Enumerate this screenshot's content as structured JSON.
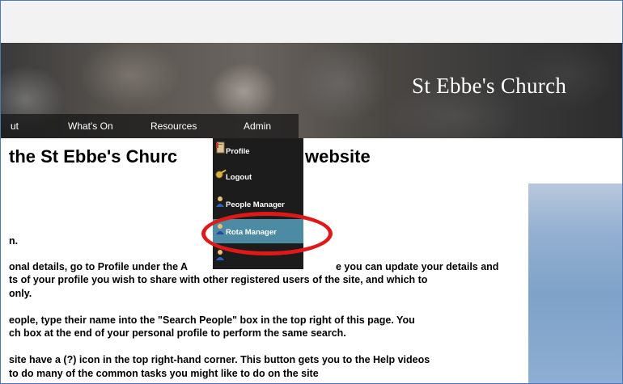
{
  "site": {
    "title": "St Ebbe's Church"
  },
  "nav": {
    "items": [
      {
        "label": "ut"
      },
      {
        "label": "What's On"
      },
      {
        "label": "Resources"
      },
      {
        "label": "Admin"
      }
    ]
  },
  "dropdown": {
    "items": [
      {
        "label": "Profile",
        "icon": "document-icon"
      },
      {
        "label": "Logout",
        "icon": "key-icon"
      },
      {
        "label": "People Manager",
        "icon": "person-icon"
      },
      {
        "label": "Rota Manager",
        "icon": "person-icon",
        "highlighted": true
      },
      {
        "label": "",
        "icon": "person-icon"
      }
    ]
  },
  "content": {
    "heading_left": "the St Ebbe's Churc",
    "heading_right": "website",
    "lines": [
      "n.",
      "onal details, go to Profile under the A",
      "ts of your profile you wish to share with other registered users of the site, and which to",
      "only.",
      "eople, type their name into the \"Search People\" box in the top right of this page.  You",
      "ch box at the end of your personal profile to perform the same search.",
      "site have a (?) icon in the top right-hand corner. This button gets you to the Help videos",
      "to do many of the common tasks you might like to do on the site"
    ],
    "line_tail": "e you can update your details and"
  },
  "annotation": {
    "color": "#e01818"
  },
  "colors": {
    "menu_bg": "#1c1c1c",
    "menu_highlight": "#4d8aa4",
    "nav_bg": "#191919"
  }
}
